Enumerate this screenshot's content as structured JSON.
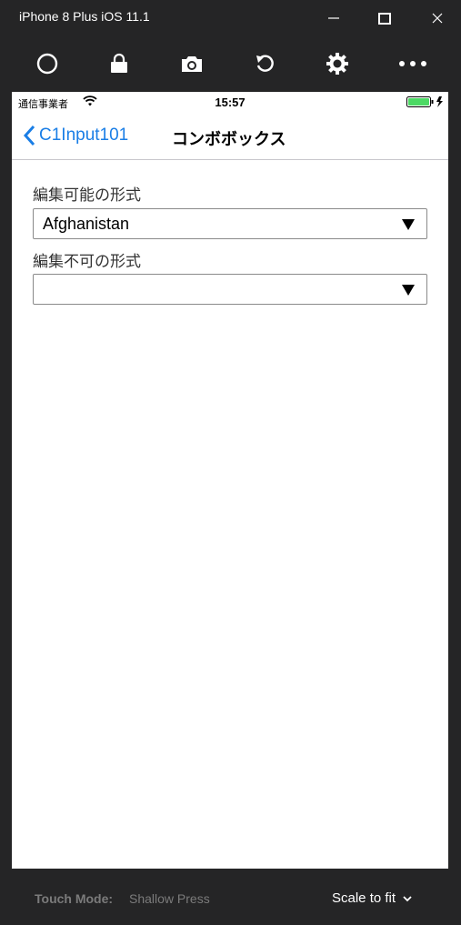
{
  "window": {
    "title": "iPhone 8 Plus iOS 11.1"
  },
  "toolbar": {
    "icons": [
      "home-icon",
      "lock-icon",
      "camera-icon",
      "rotate-icon",
      "settings-icon",
      "more-icon"
    ]
  },
  "status": {
    "carrier": "通信事業者",
    "time": "15:57",
    "battery_color": "#4cd964"
  },
  "nav": {
    "back_label": "C1Input101",
    "title": "コンボボックス",
    "accent": "#1a7ee6"
  },
  "form": {
    "editable_label": "編集可能の形式",
    "editable_value": "Afghanistan",
    "readonly_label": "編集不可の形式",
    "readonly_value": ""
  },
  "footer": {
    "touch_mode_label": "Touch Mode:",
    "touch_mode_value": "Shallow Press",
    "scale_label": "Scale to fit"
  }
}
